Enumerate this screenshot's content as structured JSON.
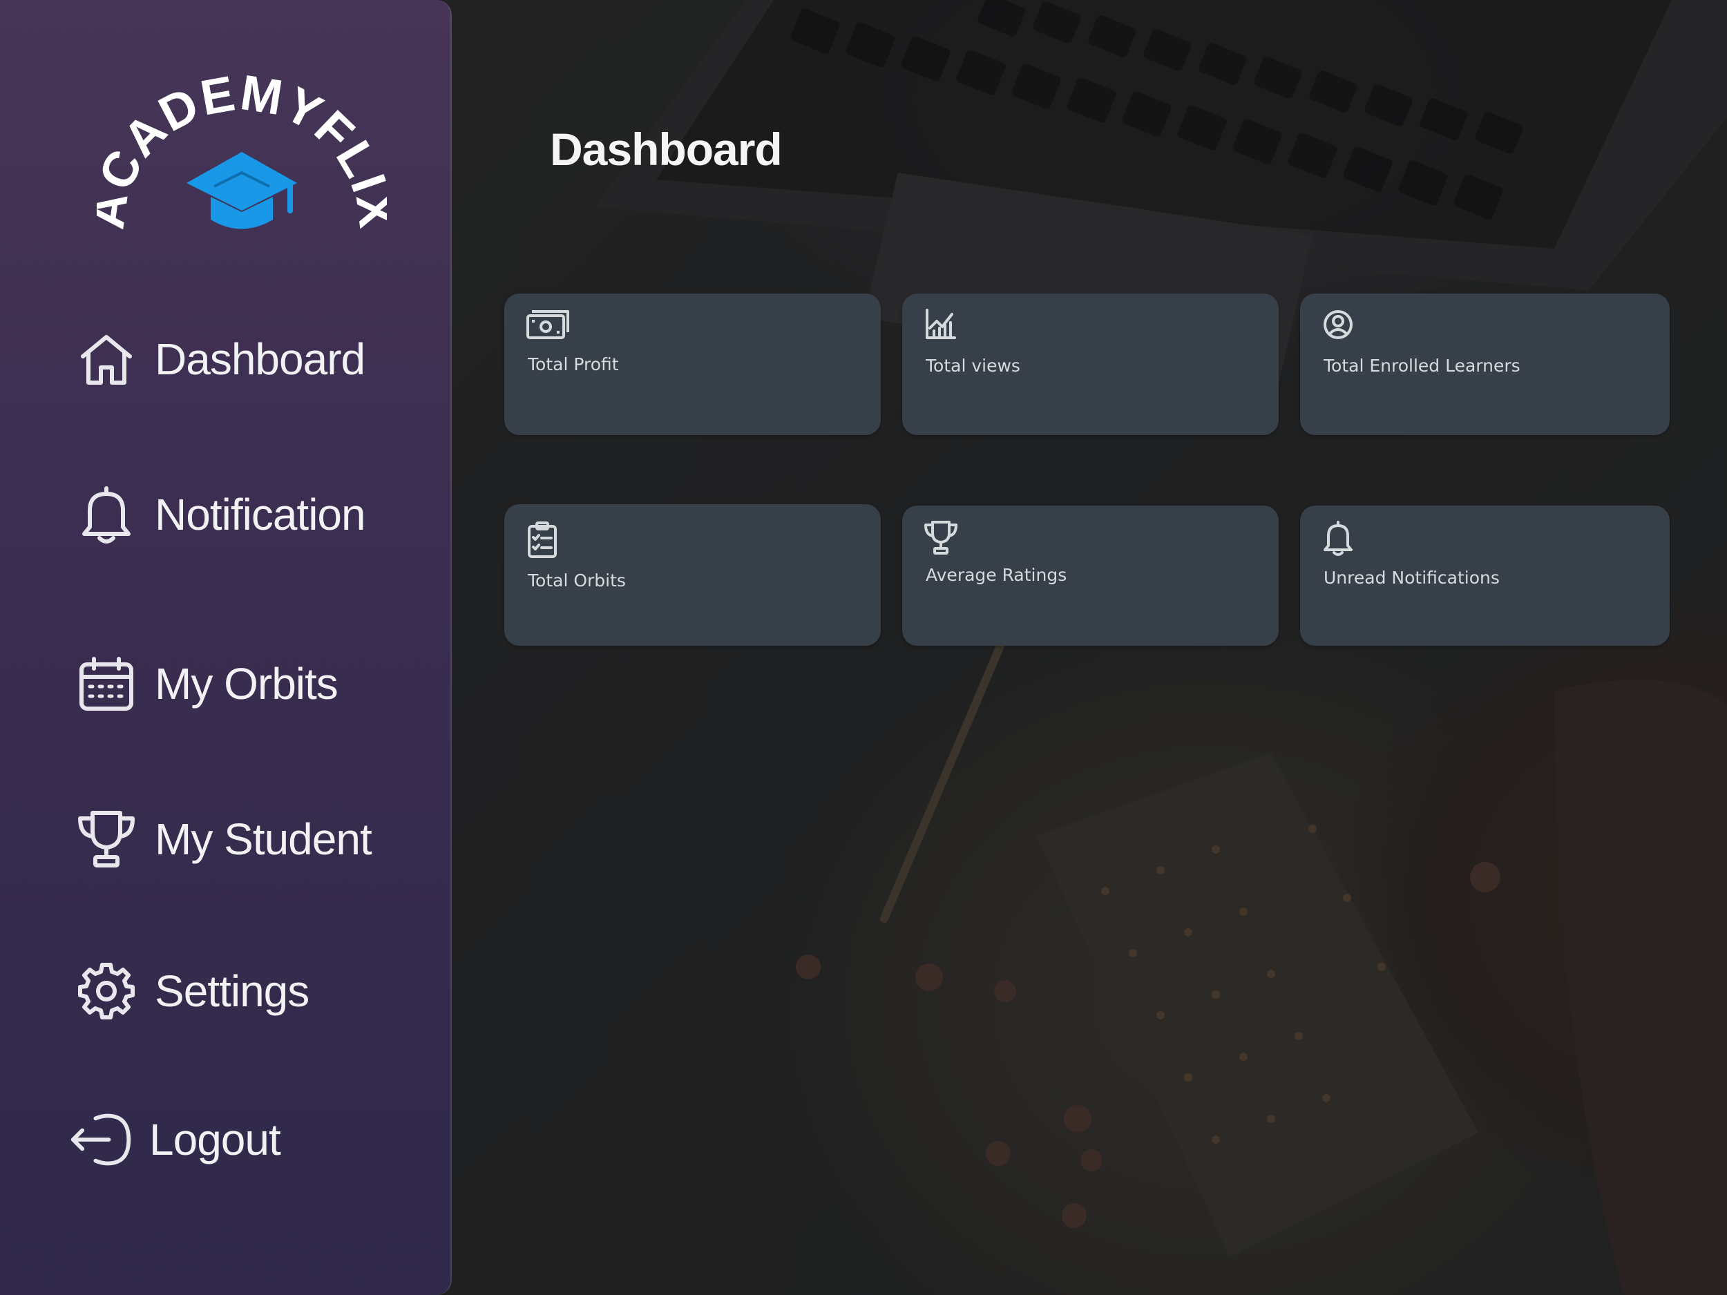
{
  "brand": {
    "name": "ACADEMYFLIX"
  },
  "nav": {
    "items": [
      {
        "label": "Dashboard",
        "icon": "home-icon"
      },
      {
        "label": "Notification",
        "icon": "bell-icon"
      },
      {
        "label": "My Orbits",
        "icon": "calendar-icon"
      },
      {
        "label": "My Student",
        "icon": "trophy-icon"
      },
      {
        "label": "Settings",
        "icon": "gear-icon"
      },
      {
        "label": "Logout",
        "icon": "logout-icon"
      }
    ]
  },
  "main": {
    "title": "Dashboard",
    "cards": [
      {
        "label": "Total Profit",
        "icon": "money-icon"
      },
      {
        "label": "Total views",
        "icon": "chart-icon"
      },
      {
        "label": "Total Enrolled Learners",
        "icon": "user-circle-icon"
      },
      {
        "label": "Total Orbits",
        "icon": "clipboard-list-icon"
      },
      {
        "label": "Average Ratings",
        "icon": "trophy-icon"
      },
      {
        "label": "Unread Notifications",
        "icon": "bell-icon"
      }
    ]
  },
  "colors": {
    "sidebar_top": "#463556",
    "sidebar_bottom": "#30294a",
    "card_bg": "#374049",
    "logo_blue": "#1a98e8"
  }
}
